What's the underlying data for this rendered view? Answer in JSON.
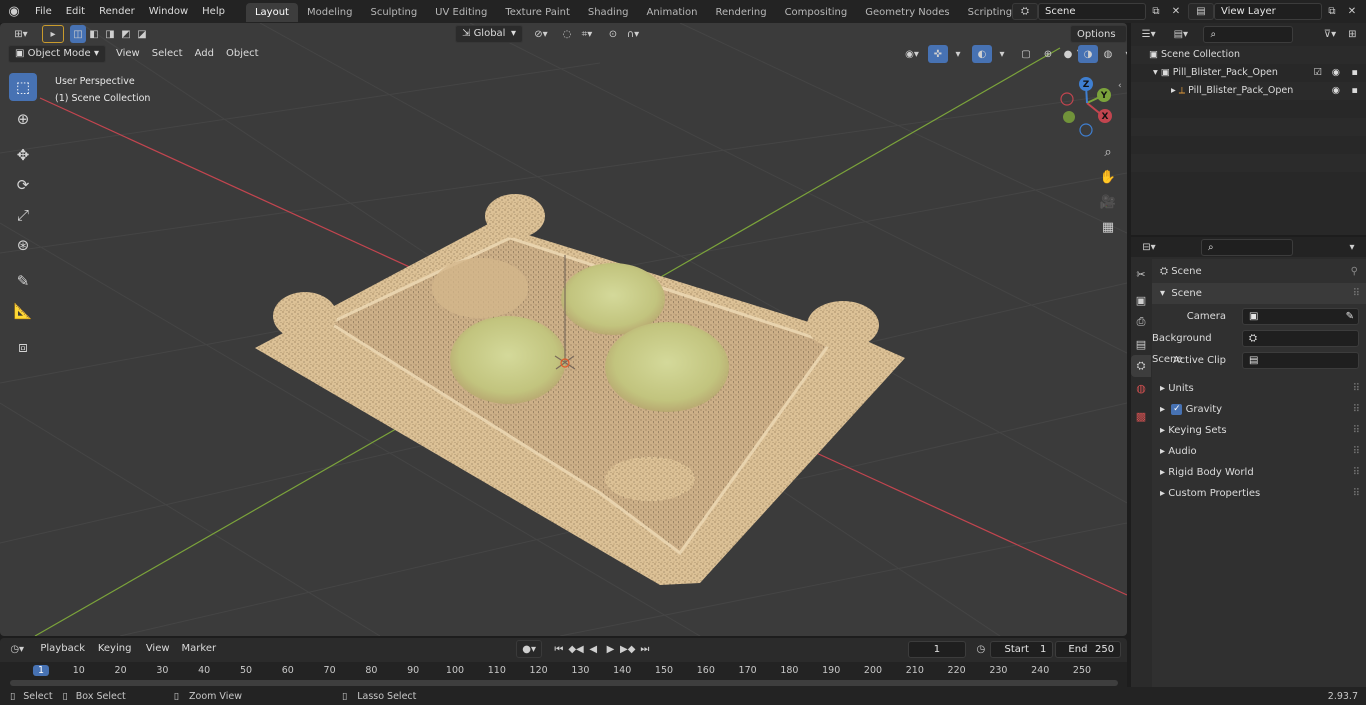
{
  "topbar": {
    "menus": [
      "File",
      "Edit",
      "Render",
      "Window",
      "Help"
    ],
    "workspaces": [
      "Layout",
      "Modeling",
      "Sculpting",
      "UV Editing",
      "Texture Paint",
      "Shading",
      "Animation",
      "Rendering",
      "Compositing",
      "Geometry Nodes",
      "Scripting"
    ],
    "active_workspace": "Layout",
    "add_tab": "+",
    "scene_name": "Scene",
    "view_layer": "View Layer"
  },
  "viewport": {
    "mode": "Object Mode",
    "menus": [
      "View",
      "Select",
      "Add",
      "Object"
    ],
    "orientation": "Global",
    "options_label": "Options",
    "perspective_label": "User Perspective",
    "collection_label": "(1) Scene Collection",
    "gizmo_axes": {
      "x": "X",
      "y": "Y",
      "z": "Z"
    }
  },
  "outliner": {
    "root": "Scene Collection",
    "collection": "Pill_Blister_Pack_Open",
    "object": "Pill_Blister_Pack_Open"
  },
  "properties": {
    "context_title": "Scene",
    "section": "Scene",
    "fields": [
      {
        "label": "Camera",
        "value": ""
      },
      {
        "label": "Background Scene",
        "value": ""
      },
      {
        "label": "Active Clip",
        "value": ""
      }
    ],
    "panels": [
      "Units",
      "Gravity",
      "Keying Sets",
      "Audio",
      "Rigid Body World",
      "Custom Properties"
    ],
    "gravity_checked": true
  },
  "timeline": {
    "menus": [
      "Playback",
      "Keying",
      "View",
      "Marker"
    ],
    "current_frame": "1",
    "start_label": "Start",
    "start_value": "1",
    "end_label": "End",
    "end_value": "250",
    "ruler": [
      "1",
      "10",
      "20",
      "30",
      "40",
      "50",
      "60",
      "70",
      "80",
      "90",
      "100",
      "110",
      "120",
      "130",
      "140",
      "150",
      "160",
      "170",
      "180",
      "190",
      "200",
      "210",
      "220",
      "230",
      "240",
      "250"
    ]
  },
  "statusbar": {
    "items": [
      "Select",
      "Box Select",
      "Zoom View",
      "Lasso Select"
    ],
    "version": "2.93.7"
  },
  "colors": {
    "accent": "#4772b3",
    "x_axis": "#c2454f",
    "y_axis": "#7ba33b",
    "z_axis": "#3f7fd1",
    "tray": "#d8b98c",
    "pill": "#c8cc88"
  }
}
